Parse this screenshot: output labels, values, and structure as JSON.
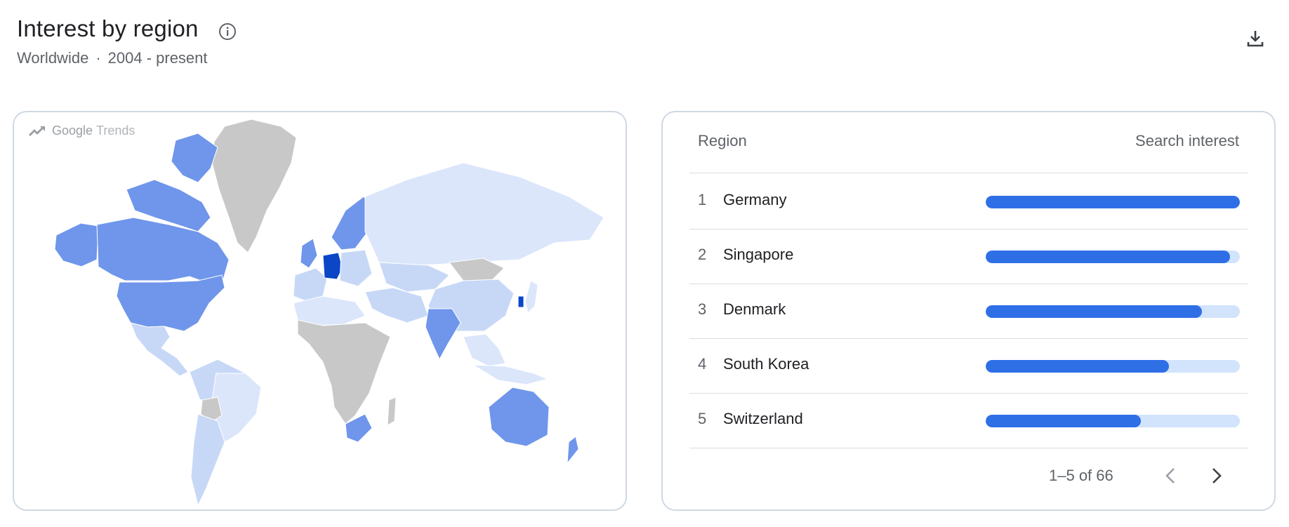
{
  "header": {
    "title": "Interest by region",
    "location": "Worldwide",
    "separator": "·",
    "time_range": "2004 - present"
  },
  "map": {
    "brand_word1": "Google",
    "brand_word2": "Trends",
    "colors": {
      "no_data": "#c8c8c8",
      "very_low": "#dbe6fb",
      "low": "#c7d8f7",
      "medium": "#8aacf0",
      "high": "#6f96ea",
      "top": "#0b46c7"
    }
  },
  "table": {
    "col_region": "Region",
    "col_interest": "Search interest",
    "rows": [
      {
        "rank": "1",
        "region": "Germany",
        "interest": 100
      },
      {
        "rank": "2",
        "region": "Singapore",
        "interest": 96
      },
      {
        "rank": "3",
        "region": "Denmark",
        "interest": 85
      },
      {
        "rank": "4",
        "region": "South Korea",
        "interest": 72
      },
      {
        "rank": "5",
        "region": "Switzerland",
        "interest": 61
      }
    ],
    "pagination": "1–5 of 66",
    "bar_color": "#2f6fe6",
    "track_color": "#d2e3fc"
  },
  "icons": {
    "info": "info-icon",
    "download": "download-icon",
    "trend": "trend-arrow-icon",
    "prev": "chevron-left-icon",
    "next": "chevron-right-icon"
  }
}
